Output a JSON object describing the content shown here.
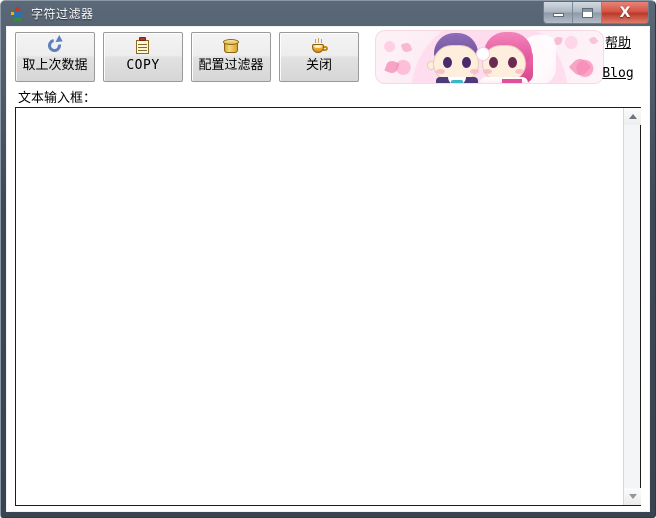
{
  "window": {
    "title": "字符过滤器",
    "icon": "app-figure-icon",
    "controls": {
      "minimize_label": "最小化",
      "maximize_label": "最大化",
      "close_label": "X"
    }
  },
  "toolbar": {
    "buttons": [
      {
        "label": "取上次数据",
        "icon": "refresh-arrow-icon",
        "script": "cjk"
      },
      {
        "label": "COPY",
        "icon": "clipboard-icon",
        "script": "latin"
      },
      {
        "label": "配置过滤器",
        "icon": "barrel-icon",
        "script": "cjk"
      },
      {
        "label": "关闭",
        "icon": "coffee-cup-icon",
        "script": "cjk"
      }
    ]
  },
  "banner": {
    "alt": "cartoon-wedding-couple-banner",
    "colors": {
      "background": "#fdf2f7",
      "groom_hair": "#6f4e9e",
      "bride_hair": "#e2509b",
      "flower": "#f38bb4"
    }
  },
  "links": [
    {
      "label": "帮助",
      "script": "cjk"
    },
    {
      "label": "Blog",
      "script": "latin"
    }
  ],
  "main": {
    "field_label": "文本输入框：",
    "textarea_value": "",
    "textarea_placeholder": ""
  },
  "scrollbar": {
    "up_label": "向上滚动",
    "down_label": "向下滚动"
  },
  "colors": {
    "titlebar": "#3d4957",
    "frame": "#38444f",
    "client": "#ffffff",
    "button_face": "#ededed",
    "close_button": "#c0392b"
  }
}
